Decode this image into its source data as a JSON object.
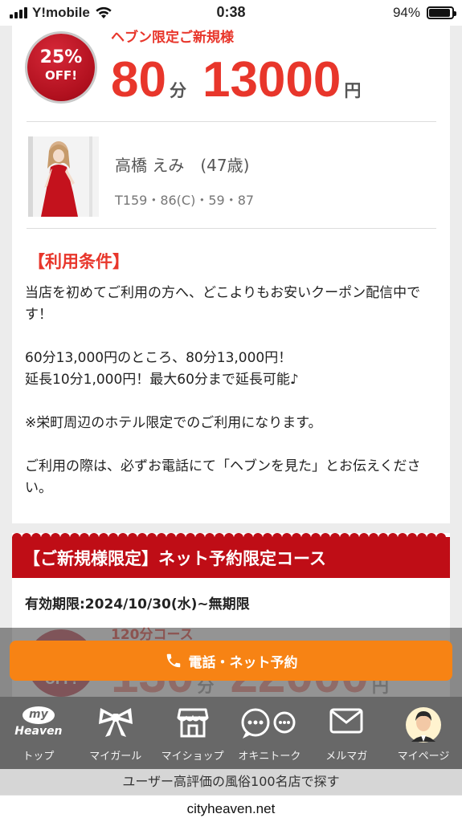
{
  "status_bar": {
    "carrier": "Y!mobile",
    "time": "0:38",
    "battery": "94%",
    "battery_level": 0.94
  },
  "coupon1": {
    "badge_pct": "25%",
    "badge_off": "OFF!",
    "label": "ヘブン限定ご新規様",
    "minutes": "80",
    "minutes_unit": "分",
    "price": "13000",
    "price_unit": "円"
  },
  "profile": {
    "name": "高橋 えみ　(47歳)",
    "measurements": "T159・86(C)・59・87"
  },
  "conditions": {
    "title": "【利用条件】",
    "paragraphs": [
      "当店を初めてご利用の方へ、どこよりもお安いクーポン配信中です！",
      "60分13,000円のところ、80分13,000円！\n延長10分1,000円！最大60分まで延長可能♪",
      "※栄町周辺のホテル限定でのご利用になります。",
      "ご利用の際は、必ずお電話にて「ヘブンを見た」とお伝えください。"
    ]
  },
  "coupon2": {
    "header": "【ご新規様限定】ネット予約限定コース",
    "expiry": "有効期限:2024/10/30(水)~無期限",
    "badge_off": "OFF!",
    "course": "120分コース",
    "minutes": "130",
    "minutes_unit": "分",
    "price": "22000",
    "price_unit": "円"
  },
  "reserve_button": {
    "label": "電話・ネット予約"
  },
  "bottom_nav": [
    {
      "label": "トップ",
      "icon": "my-heaven-logo-icon",
      "logo_top": "my",
      "logo_bottom": "Heaven"
    },
    {
      "label": "マイガール",
      "icon": "ribbon-icon"
    },
    {
      "label": "マイショップ",
      "icon": "shop-icon"
    },
    {
      "label": "オキニトーク",
      "icon": "chat-bubbles-icon"
    },
    {
      "label": "メルマガ",
      "icon": "mail-icon"
    },
    {
      "label": "マイページ",
      "icon": "avatar-icon"
    }
  ],
  "banner": "ユーザー高評価の風俗100名店で探す",
  "url": "cityheaven.net",
  "colors": {
    "accent_red": "#e8362b",
    "header_red": "#bf0d16",
    "button_orange": "#f78314",
    "nav_gray": "#686868"
  }
}
